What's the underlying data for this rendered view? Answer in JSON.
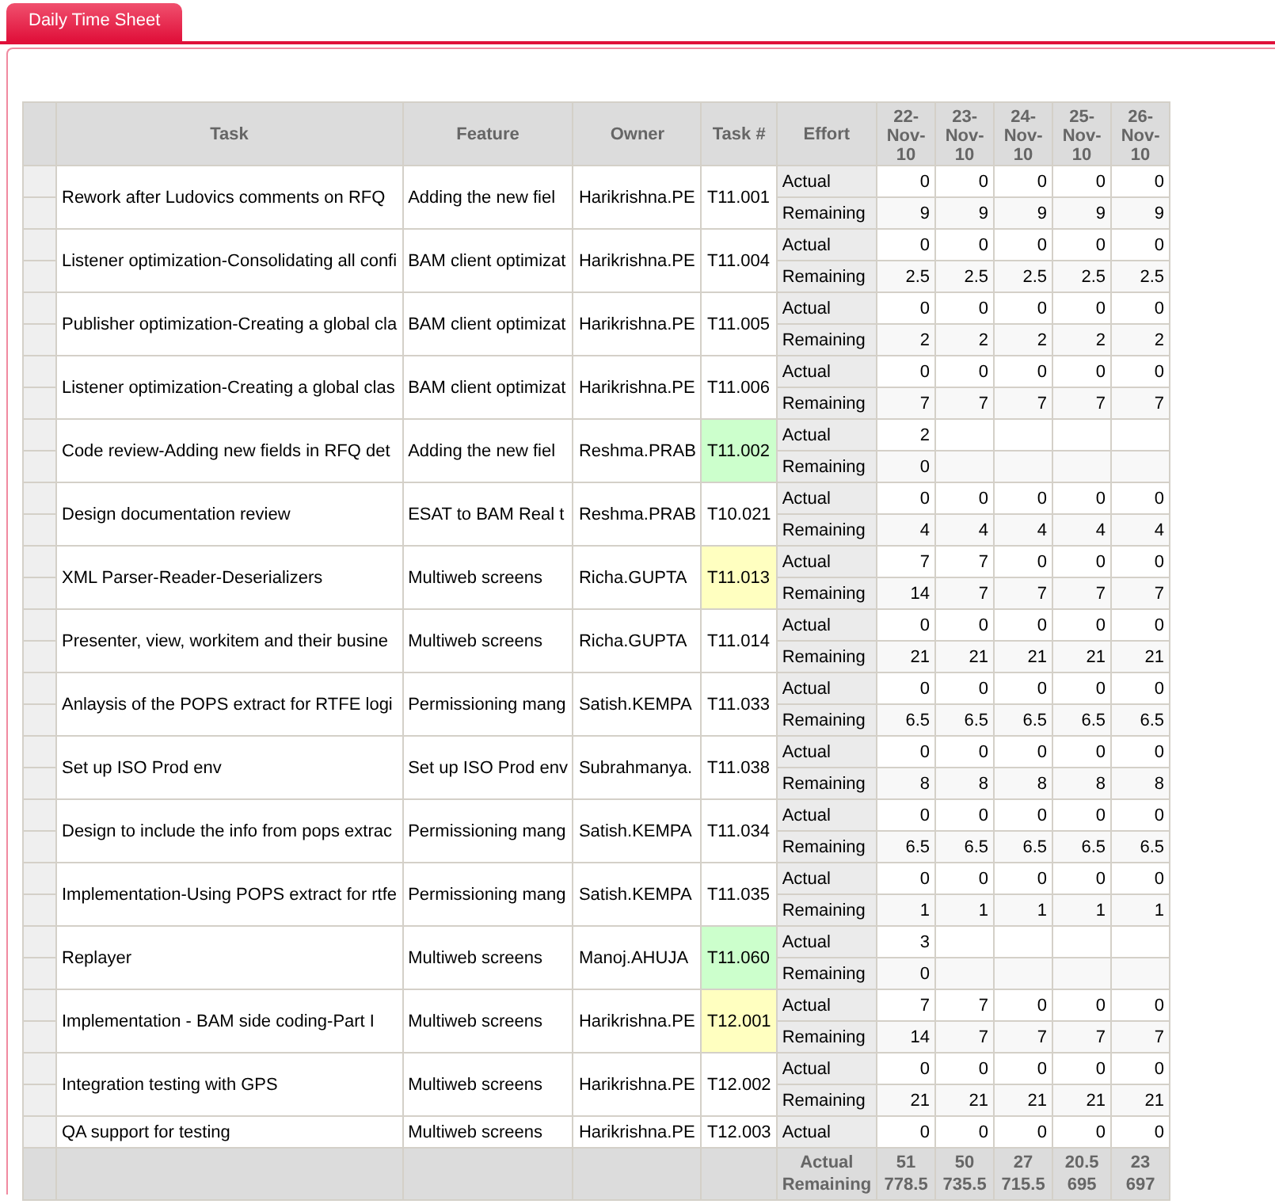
{
  "tabs": [
    {
      "label": "Daily Time Sheet",
      "selected": true
    }
  ],
  "table": {
    "columns": [
      "Task",
      "Feature",
      "Owner",
      "Task #",
      "Effort"
    ],
    "days": [
      "22-Nov-10",
      "23-Nov-10",
      "24-Nov-10",
      "25-Nov-10",
      "26-Nov-10"
    ],
    "rows": [
      {
        "task": "Rework after Ludovics comments on RFQ",
        "feature": "Adding the new fiel",
        "owner": "Harikrishna.PE",
        "task_no": "T11.001",
        "effort": [
          {
            "label": "Actual",
            "values": [
              "0",
              "0",
              "0",
              "0",
              "0"
            ]
          },
          {
            "label": "Remaining",
            "values": [
              "9",
              "9",
              "9",
              "9",
              "9"
            ]
          }
        ]
      },
      {
        "task": "Listener optimization-Consolidating all confi",
        "feature": "BAM client optimizat",
        "owner": "Harikrishna.PE",
        "task_no": "T11.004",
        "effort": [
          {
            "label": "Actual",
            "values": [
              "0",
              "0",
              "0",
              "0",
              "0"
            ]
          },
          {
            "label": "Remaining",
            "values": [
              "2.5",
              "2.5",
              "2.5",
              "2.5",
              "2.5"
            ]
          }
        ]
      },
      {
        "task": "Publisher optimization-Creating a global cla",
        "feature": "BAM client optimizat",
        "owner": "Harikrishna.PE",
        "task_no": "T11.005",
        "effort": [
          {
            "label": "Actual",
            "values": [
              "0",
              "0",
              "0",
              "0",
              "0"
            ]
          },
          {
            "label": "Remaining",
            "values": [
              "2",
              "2",
              "2",
              "2",
              "2"
            ]
          }
        ]
      },
      {
        "task": "Listener optimization-Creating a global clas",
        "feature": "BAM client optimizat",
        "owner": "Harikrishna.PE",
        "task_no": "T11.006",
        "effort": [
          {
            "label": "Actual",
            "values": [
              "0",
              "0",
              "0",
              "0",
              "0"
            ]
          },
          {
            "label": "Remaining",
            "values": [
              "7",
              "7",
              "7",
              "7",
              "7"
            ]
          }
        ]
      },
      {
        "task": "Code review-Adding new fields in RFQ det",
        "feature": "Adding the new fiel",
        "owner": "Reshma.PRAB",
        "task_no": "T11.002",
        "color": "#ccffcc",
        "effort": [
          {
            "label": "Actual",
            "values": [
              "2"
            ]
          },
          {
            "label": "Remaining",
            "values": [
              "0"
            ]
          }
        ]
      },
      {
        "task": "Design documentation review",
        "feature": "ESAT to BAM Real t",
        "owner": "Reshma.PRAB",
        "task_no": "T10.021",
        "effort": [
          {
            "label": "Actual",
            "values": [
              "0",
              "0",
              "0",
              "0",
              "0"
            ]
          },
          {
            "label": "Remaining",
            "values": [
              "4",
              "4",
              "4",
              "4",
              "4"
            ]
          }
        ]
      },
      {
        "task": "XML Parser-Reader-Deserializers",
        "feature": "Multiweb screens",
        "owner": "Richa.GUPTA",
        "task_no": "T11.013",
        "color": "#ffffc0",
        "effort": [
          {
            "label": "Actual",
            "values": [
              "7",
              "7",
              "0",
              "0",
              "0"
            ]
          },
          {
            "label": "Remaining",
            "values": [
              "14",
              "7",
              "7",
              "7",
              "7"
            ]
          }
        ]
      },
      {
        "task": "Presenter, view, workitem and their busine",
        "feature": "Multiweb screens",
        "owner": "Richa.GUPTA",
        "task_no": "T11.014",
        "effort": [
          {
            "label": "Actual",
            "values": [
              "0",
              "0",
              "0",
              "0",
              "0"
            ]
          },
          {
            "label": "Remaining",
            "values": [
              "21",
              "21",
              "21",
              "21",
              "21"
            ]
          }
        ]
      },
      {
        "task": "Anlaysis of the POPS extract for RTFE logi",
        "feature": "Permissioning mang",
        "owner": "Satish.KEMPA",
        "task_no": "T11.033",
        "effort": [
          {
            "label": "Actual",
            "values": [
              "0",
              "0",
              "0",
              "0",
              "0"
            ]
          },
          {
            "label": "Remaining",
            "values": [
              "6.5",
              "6.5",
              "6.5",
              "6.5",
              "6.5"
            ]
          }
        ]
      },
      {
        "task": "Set up ISO Prod env",
        "feature": "Set up ISO Prod env",
        "owner": "Subrahmanya.",
        "task_no": "T11.038",
        "effort": [
          {
            "label": "Actual",
            "values": [
              "0",
              "0",
              "0",
              "0",
              "0"
            ]
          },
          {
            "label": "Remaining",
            "values": [
              "8",
              "8",
              "8",
              "8",
              "8"
            ]
          }
        ]
      },
      {
        "task": "Design to include the info from pops extrac",
        "feature": "Permissioning mang",
        "owner": "Satish.KEMPA",
        "task_no": "T11.034",
        "effort": [
          {
            "label": "Actual",
            "values": [
              "0",
              "0",
              "0",
              "0",
              "0"
            ]
          },
          {
            "label": "Remaining",
            "values": [
              "6.5",
              "6.5",
              "6.5",
              "6.5",
              "6.5"
            ]
          }
        ]
      },
      {
        "task": "Implementation-Using POPS extract for rtfe",
        "feature": "Permissioning mang",
        "owner": "Satish.KEMPA",
        "task_no": "T11.035",
        "effort": [
          {
            "label": "Actual",
            "values": [
              "0",
              "0",
              "0",
              "0",
              "0"
            ]
          },
          {
            "label": "Remaining",
            "values": [
              "1",
              "1",
              "1",
              "1",
              "1"
            ]
          }
        ]
      },
      {
        "task": "Replayer",
        "feature": "Multiweb screens",
        "owner": "Manoj.AHUJA",
        "task_no": "T11.060",
        "color": "#ccffcc",
        "effort": [
          {
            "label": "Actual",
            "values": [
              "3"
            ]
          },
          {
            "label": "Remaining",
            "values": [
              "0"
            ]
          }
        ]
      },
      {
        "task": "Implementation - BAM side coding-Part I",
        "feature": "Multiweb screens",
        "owner": "Harikrishna.PE",
        "task_no": "T12.001",
        "color": "#ffffc0",
        "effort": [
          {
            "label": "Actual",
            "values": [
              "7",
              "7",
              "0",
              "0",
              "0"
            ]
          },
          {
            "label": "Remaining",
            "values": [
              "14",
              "7",
              "7",
              "7",
              "7"
            ]
          }
        ]
      },
      {
        "task": "Integration testing with GPS",
        "feature": "Multiweb screens",
        "owner": "Harikrishna.PE",
        "task_no": "T12.002",
        "effort": [
          {
            "label": "Actual",
            "values": [
              "0",
              "0",
              "0",
              "0",
              "0"
            ]
          },
          {
            "label": "Remaining",
            "values": [
              "21",
              "21",
              "21",
              "21",
              "21"
            ]
          }
        ]
      },
      {
        "task": "QA support for testing",
        "feature": "Multiweb screens",
        "owner": "Harikrishna.PE",
        "task_no": "T12.003",
        "effort": [
          {
            "label": "Actual",
            "values": [
              "0",
              "0",
              "0",
              "0",
              "0"
            ]
          }
        ]
      }
    ],
    "totals": {
      "labels": [
        "Actual",
        "Remaining"
      ],
      "actual": [
        "51",
        "50",
        "27",
        "20.5",
        "23"
      ],
      "remaining": [
        "778.5",
        "735.5",
        "715.5",
        "695",
        "697"
      ]
    }
  }
}
